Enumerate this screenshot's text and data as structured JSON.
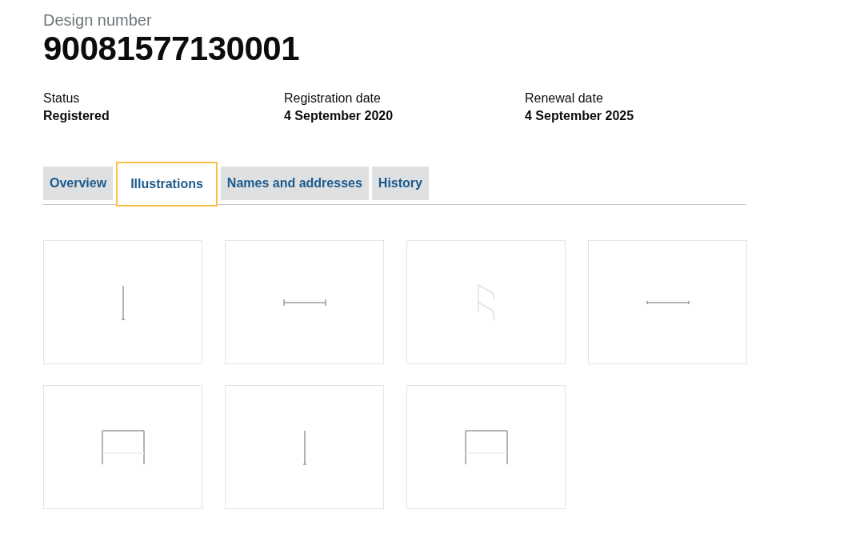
{
  "caption": "Design number",
  "design_number": "90081577130001",
  "summary": [
    {
      "label": "Status",
      "value": "Registered"
    },
    {
      "label": "Registration date",
      "value": "4 September 2020"
    },
    {
      "label": "Renewal date",
      "value": "4 September 2025"
    }
  ],
  "tabs": [
    {
      "label": "Overview",
      "selected": false
    },
    {
      "label": "Illustrations",
      "selected": true
    },
    {
      "label": "Names and addresses",
      "selected": false
    },
    {
      "label": "History",
      "selected": false
    }
  ],
  "illustrations": [
    {
      "kind": "vertical"
    },
    {
      "kind": "horizontal"
    },
    {
      "kind": "angled"
    },
    {
      "kind": "rail"
    },
    {
      "kind": "frame"
    },
    {
      "kind": "vertical"
    },
    {
      "kind": "frame"
    }
  ]
}
